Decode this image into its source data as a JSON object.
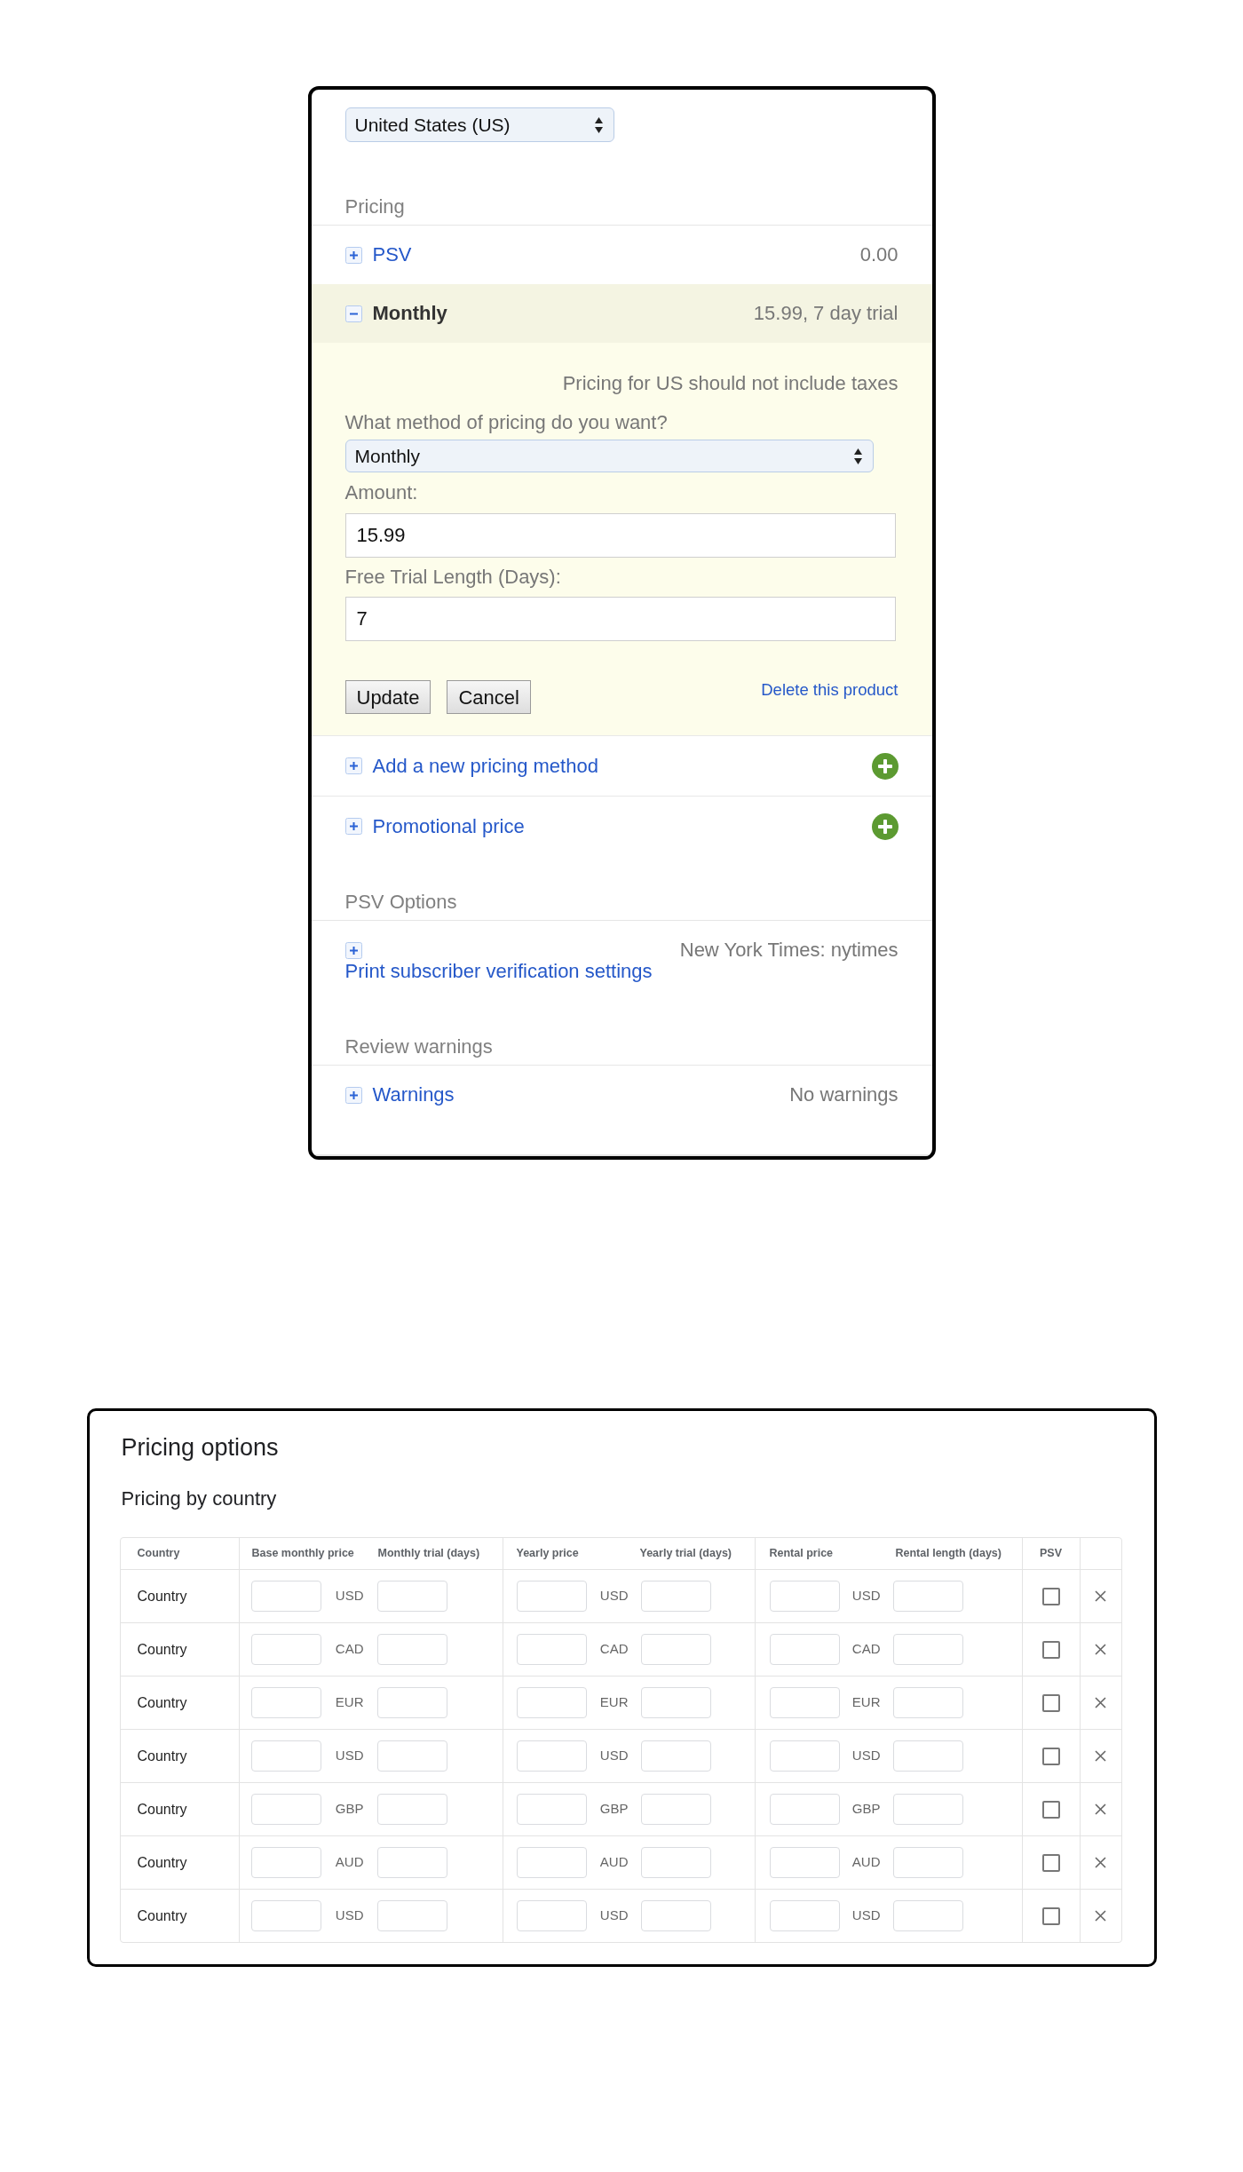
{
  "country_select": {
    "value": "United States (US)"
  },
  "pricing": {
    "heading": "Pricing",
    "items": [
      {
        "kind": "summary",
        "label": "PSV",
        "summary": "0.00",
        "expanded": false
      },
      {
        "kind": "summary",
        "label": "Monthly",
        "summary": "15.99, 7 day trial",
        "expanded": true,
        "editor": {
          "note": "Pricing for US should not include taxes",
          "method_label": "What method of pricing do you want?",
          "method_value": "Monthly",
          "amount_label": "Amount:",
          "amount_value": "15.99",
          "trial_label": "Free Trial Length (Days):",
          "trial_value": "7",
          "buttons": [
            "Update",
            "Cancel"
          ],
          "delete_link": "Delete this product"
        }
      },
      {
        "kind": "add",
        "label": "Add a new pricing method",
        "expanded": false
      },
      {
        "kind": "add",
        "label": "Promotional price",
        "expanded": false
      }
    ]
  },
  "psv_options": {
    "heading": "PSV Options",
    "items": [
      {
        "kind": "stacked",
        "label": "Print subscriber verification settings",
        "summary": "New York Times: nytimes",
        "expanded": false
      }
    ]
  },
  "review_warnings": {
    "heading": "Review warnings",
    "items": [
      {
        "kind": "summary",
        "label": "Warnings",
        "summary": "No warnings",
        "expanded": false
      }
    ]
  },
  "pricing_options": {
    "title": "Pricing options",
    "subtitle": "Pricing by country",
    "table": {
      "columns": [
        "Country",
        "Base monthly price",
        "Monthly trial (days)",
        "Yearly price",
        "Yearly trial (days)",
        "Rental price",
        "Rental length (days)",
        "PSV"
      ],
      "rows": [
        {
          "country": "Country",
          "monthly_currency": "USD",
          "yearly_currency": "USD",
          "rental_currency": "USD",
          "psv_checked": false
        },
        {
          "country": "Country",
          "monthly_currency": "CAD",
          "yearly_currency": "CAD",
          "rental_currency": "CAD",
          "psv_checked": false
        },
        {
          "country": "Country",
          "monthly_currency": "EUR",
          "yearly_currency": "EUR",
          "rental_currency": "EUR",
          "psv_checked": false
        },
        {
          "country": "Country",
          "monthly_currency": "USD",
          "yearly_currency": "USD",
          "rental_currency": "USD",
          "psv_checked": false
        },
        {
          "country": "Country",
          "monthly_currency": "GBP",
          "yearly_currency": "GBP",
          "rental_currency": "GBP",
          "psv_checked": false
        },
        {
          "country": "Country",
          "monthly_currency": "AUD",
          "yearly_currency": "AUD",
          "rental_currency": "AUD",
          "psv_checked": false
        },
        {
          "country": "Country",
          "monthly_currency": "USD",
          "yearly_currency": "USD",
          "rental_currency": "USD",
          "psv_checked": false
        }
      ]
    }
  }
}
